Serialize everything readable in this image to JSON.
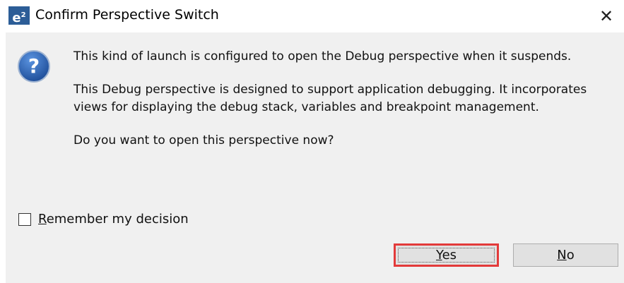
{
  "window": {
    "title": "Confirm Perspective Switch",
    "logo_text": "e",
    "logo_sup": "2",
    "close_glyph": "✕"
  },
  "message": {
    "line1": "This kind of launch is configured to open the Debug perspective when it suspends.",
    "line2": "This Debug perspective is designed to support application debugging.  It incorporates views for displaying the debug stack, variables and breakpoint management.",
    "line3": "Do you want to open this perspective now?"
  },
  "remember": {
    "mnemonic": "R",
    "rest": "emember my decision",
    "checked": false
  },
  "buttons": {
    "yes_mnemonic": "Y",
    "yes_rest": "es",
    "no_mnemonic": "N",
    "no_rest": "o"
  },
  "colors": {
    "highlight_border": "#e33a3a",
    "logo_bg": "#2c5d97",
    "question_icon": "#1f5fb0"
  },
  "icons": [
    "question-icon",
    "close-icon",
    "app-logo"
  ]
}
